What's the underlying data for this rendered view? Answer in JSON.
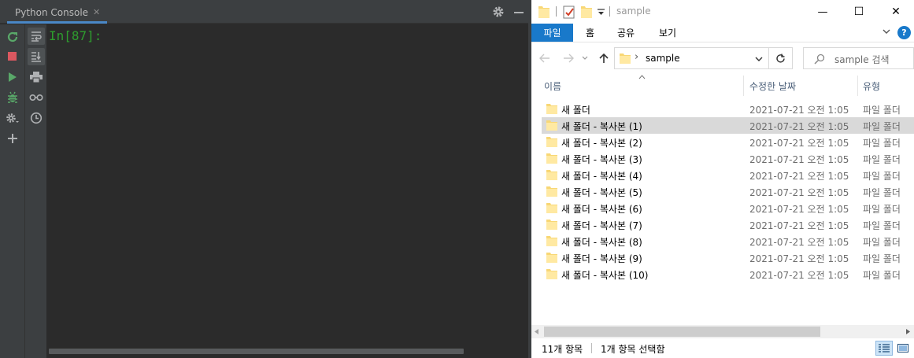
{
  "console": {
    "tab_label": "Python Console",
    "tab_close": "✕",
    "prompt": "In[87]:"
  },
  "explorer": {
    "title": "sample",
    "window_controls": {
      "minimize": "—",
      "maximize": "☐",
      "close": "✕"
    },
    "ribbon": {
      "file": "파일",
      "home": "홈",
      "share": "공유",
      "view": "보기",
      "help": "?"
    },
    "address": {
      "crumb_sep": "›",
      "path": "sample"
    },
    "search": {
      "placeholder": "sample 검색"
    },
    "columns": {
      "name": "이름",
      "date": "수정한 날짜",
      "type": "유형"
    },
    "files": [
      {
        "name": "새 폴더",
        "date": "2021-07-21 오전 1:05",
        "type": "파일 폴더",
        "selected": false
      },
      {
        "name": "새 폴더 - 복사본 (1)",
        "date": "2021-07-21 오전 1:05",
        "type": "파일 폴더",
        "selected": true
      },
      {
        "name": "새 폴더 - 복사본 (2)",
        "date": "2021-07-21 오전 1:05",
        "type": "파일 폴더",
        "selected": false
      },
      {
        "name": "새 폴더 - 복사본 (3)",
        "date": "2021-07-21 오전 1:05",
        "type": "파일 폴더",
        "selected": false
      },
      {
        "name": "새 폴더 - 복사본 (4)",
        "date": "2021-07-21 오전 1:05",
        "type": "파일 폴더",
        "selected": false
      },
      {
        "name": "새 폴더 - 복사본 (5)",
        "date": "2021-07-21 오전 1:05",
        "type": "파일 폴더",
        "selected": false
      },
      {
        "name": "새 폴더 - 복사본 (6)",
        "date": "2021-07-21 오전 1:05",
        "type": "파일 폴더",
        "selected": false
      },
      {
        "name": "새 폴더 - 복사본 (7)",
        "date": "2021-07-21 오전 1:05",
        "type": "파일 폴더",
        "selected": false
      },
      {
        "name": "새 폴더 - 복사본 (8)",
        "date": "2021-07-21 오전 1:05",
        "type": "파일 폴더",
        "selected": false
      },
      {
        "name": "새 폴더 - 복사본 (9)",
        "date": "2021-07-21 오전 1:05",
        "type": "파일 폴더",
        "selected": false
      },
      {
        "name": "새 폴더 - 복사본 (10)",
        "date": "2021-07-21 오전 1:05",
        "type": "파일 폴더",
        "selected": false
      }
    ],
    "status": {
      "count": "11개 항목",
      "selection": "1개 항목 선택함"
    }
  },
  "colors": {
    "accent": "#1979ca",
    "console_bg": "#2b2b2b",
    "prompt": "#2e9d2e",
    "selection": "#d9d9d9"
  }
}
